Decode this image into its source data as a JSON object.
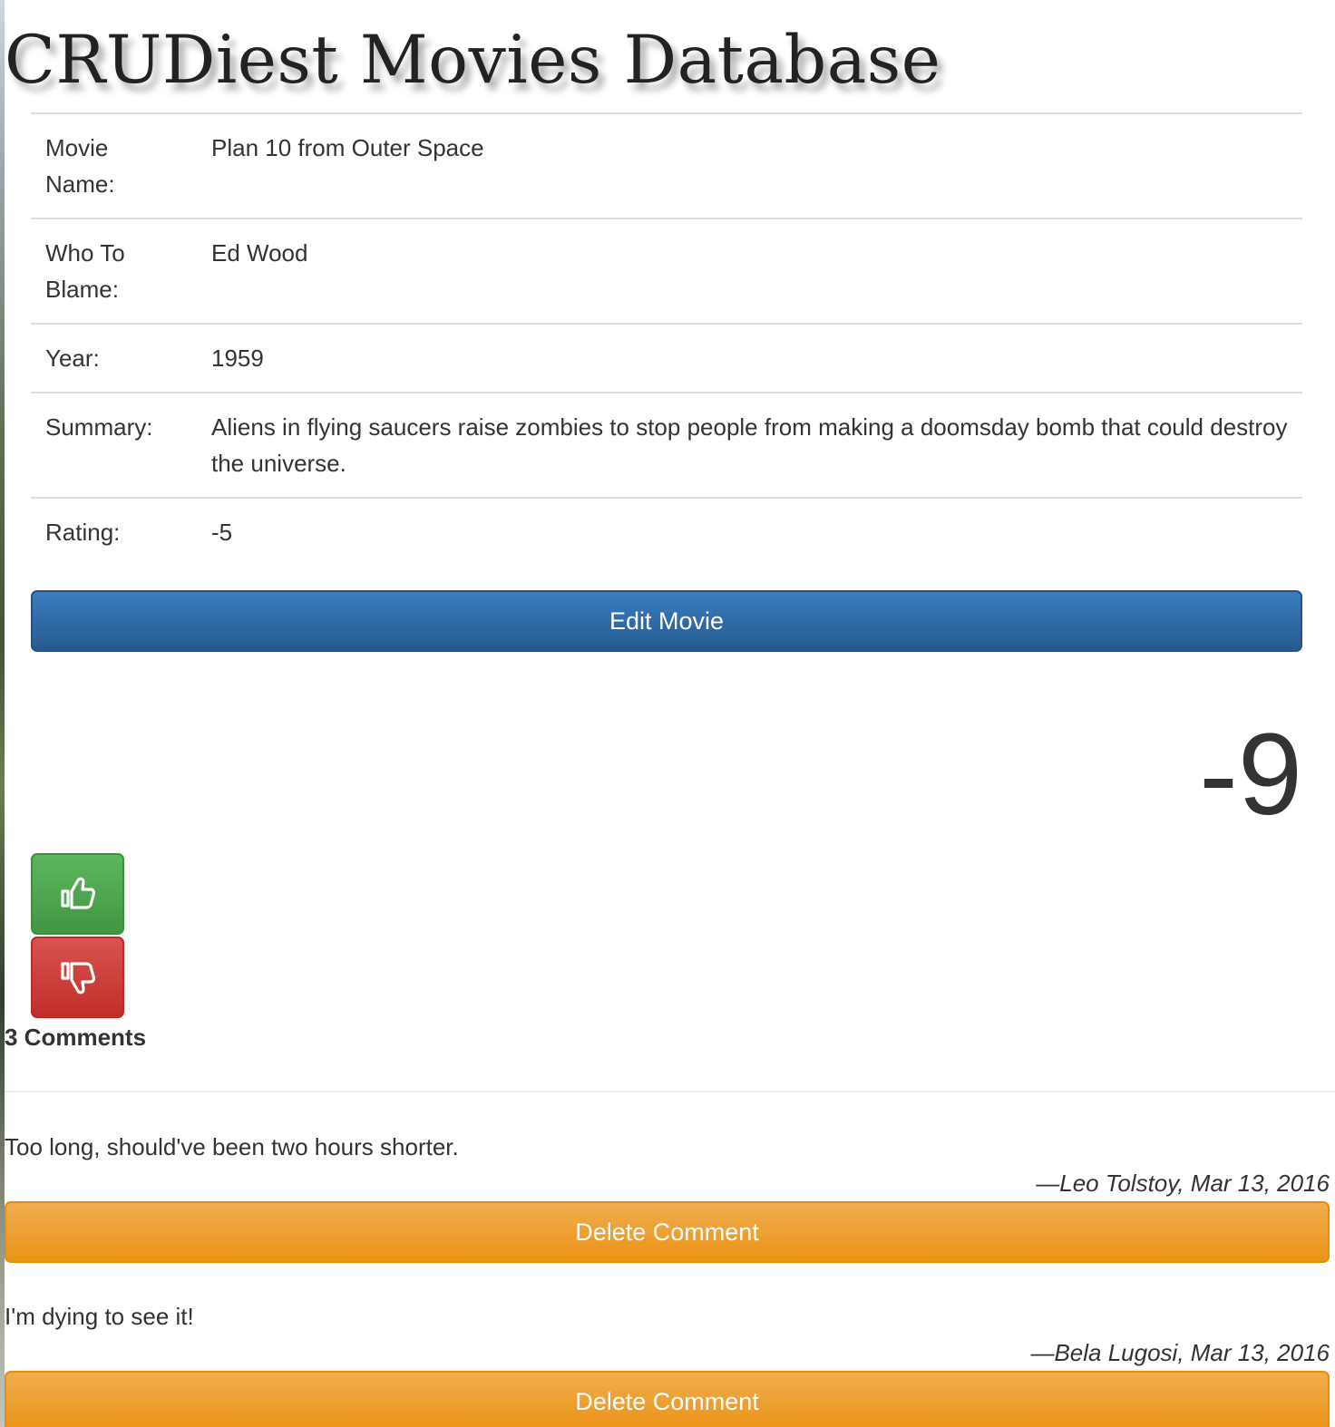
{
  "site": {
    "title": "CRUDiest Movies Database"
  },
  "movie": {
    "fields": [
      {
        "label": "Movie Name:",
        "value": "Plan 10 from Outer Space"
      },
      {
        "label": "Who To Blame:",
        "value": "Ed Wood"
      },
      {
        "label": "Year:",
        "value": "1959"
      },
      {
        "label": "Summary:",
        "value": "Aliens in flying saucers raise zombies to stop people from making a doomsday bomb that could destroy the universe."
      },
      {
        "label": "Rating:",
        "value": "-5"
      }
    ],
    "edit_label": "Edit Movie"
  },
  "votes": {
    "score": "-9",
    "up_icon": "thumbs-up-icon",
    "down_icon": "thumbs-down-icon"
  },
  "comments": {
    "count_label": "3 Comments",
    "items": [
      {
        "text": "Too long, should've been two hours shorter.",
        "attribution": "—Leo Tolstoy, Mar 13, 2016",
        "delete_label": "Delete Comment"
      },
      {
        "text": "I'm dying to see it!",
        "attribution": "—Bela Lugosi, Mar 13, 2016",
        "delete_label": "Delete Comment"
      }
    ]
  },
  "colors": {
    "primary": "#337ab7",
    "success": "#5cb85c",
    "danger": "#d9534f",
    "warning": "#f0ad4e"
  }
}
